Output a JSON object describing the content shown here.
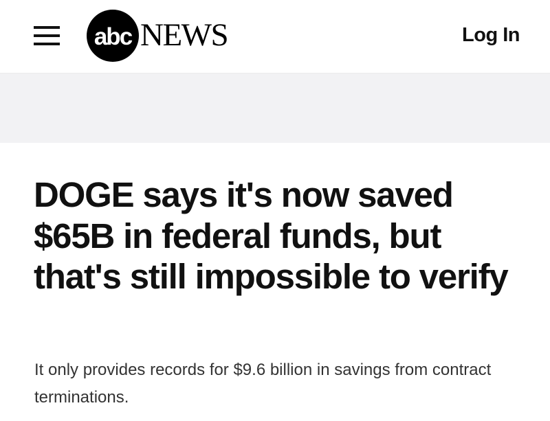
{
  "header": {
    "menu_icon": "hamburger-menu-icon",
    "logo": {
      "badge_text": "abc",
      "wordmark": "NEWS"
    },
    "login_label": "Log In"
  },
  "article": {
    "headline": "DOGE says it's now saved $65B in federal funds, but that's still impossible to verify",
    "subheadline": "It only provides records for $9.6 billion in savings from contract terminations."
  },
  "colors": {
    "text": "#111111",
    "subtext": "#333333",
    "ad_band": "#f2f2f4",
    "logo_badge": "#000000"
  }
}
